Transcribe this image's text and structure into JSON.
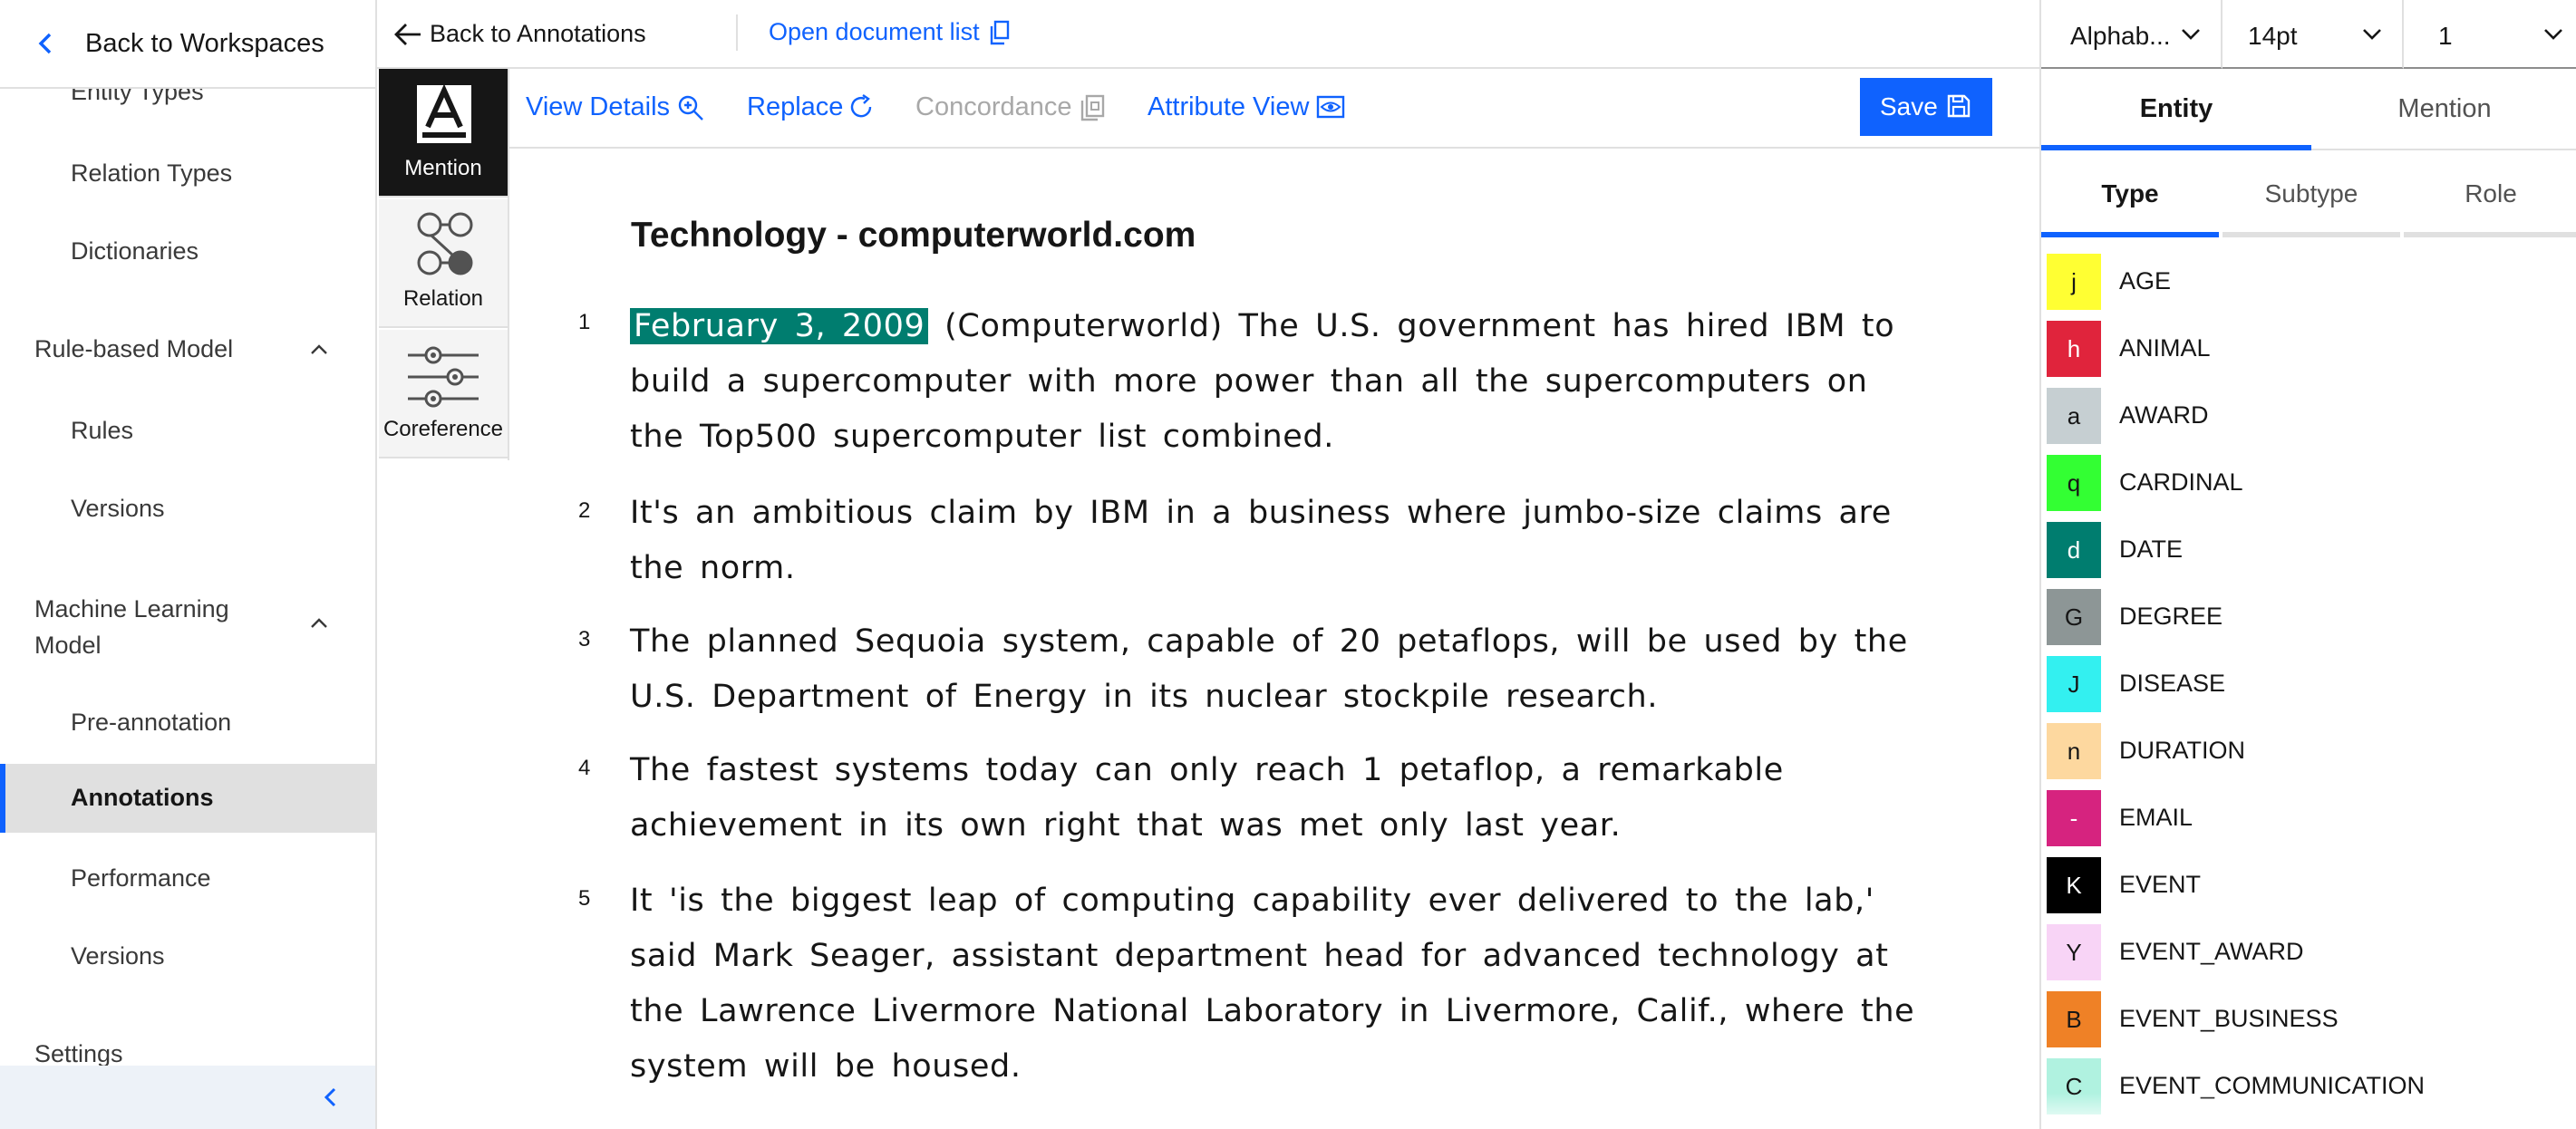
{
  "nav": {
    "back_label": "Back to Workspaces",
    "entity_types": "Entity Types",
    "relation_types": "Relation Types",
    "dictionaries": "Dictionaries",
    "rule_based_model": "Rule-based Model",
    "rules": "Rules",
    "rb_versions": "Versions",
    "ml_model_line1": "Machine Learning",
    "ml_model_line2": "Model",
    "pre_annotation": "Pre-annotation",
    "annotations": "Annotations",
    "performance": "Performance",
    "ml_versions": "Versions",
    "settings": "Settings"
  },
  "header": {
    "back_label": "Back to Annotations",
    "open_doc_label": "Open document list"
  },
  "tools": {
    "mention": "Mention",
    "relation": "Relation",
    "coreference": "Coreference"
  },
  "toolbar": {
    "view_details": "View Details",
    "replace": "Replace",
    "concordance": "Concordance",
    "attribute_view": "Attribute View",
    "save": "Save"
  },
  "document": {
    "title": "Technology - computerworld.com",
    "paragraphs": [
      {
        "num": "1",
        "highlight": "February 3, 2009",
        "text": " (Computerworld) The U.S. government has hired IBM to build  a supercomputer with more power than all the supercomputers on the Top500 supercomputer list combined."
      },
      {
        "num": "2",
        "text": "It's an ambitious claim by IBM in a business where jumbo-size claims are the norm."
      },
      {
        "num": "3",
        "text": "The planned Sequoia system, capable of 20 petaflops, will be used by the U.S. Department of Energy in its nuclear stockpile research."
      },
      {
        "num": "4",
        "text": "The fastest systems today can only reach 1 petaflop, a remarkable achievement in its own right that was met only last year."
      },
      {
        "num": "5",
        "text": "It 'is the biggest leap of computing capability ever delivered to the lab,' said Mark Seager, assistant department head for advanced technology at the Lawrence Livermore National Laboratory in Livermore, Calif., where the system will be housed."
      }
    ],
    "highlight_color": "#007d6f"
  },
  "right_panel": {
    "sort_value": "Alphab...",
    "font_size_value": "14pt",
    "line_spacing_value": "1",
    "tabs": [
      "Entity",
      "Mention"
    ],
    "subtabs": [
      "Type",
      "Subtype",
      "Role"
    ],
    "entities": [
      {
        "key": "j",
        "name": "AGE",
        "color": "#ffff33",
        "text_color": "#161616"
      },
      {
        "key": "h",
        "name": "ANIMAL",
        "color": "#e0243c",
        "text_color": "#ffffff"
      },
      {
        "key": "a",
        "name": "AWARD",
        "color": "#c6cfd2",
        "text_color": "#161616"
      },
      {
        "key": "q",
        "name": "CARDINAL",
        "color": "#33ff33",
        "text_color": "#161616"
      },
      {
        "key": "d",
        "name": "DATE",
        "color": "#007d6f",
        "text_color": "#ffffff"
      },
      {
        "key": "G",
        "name": "DEGREE",
        "color": "#8d9696",
        "text_color": "#161616"
      },
      {
        "key": "J",
        "name": "DISEASE",
        "color": "#33f0f0",
        "text_color": "#161616"
      },
      {
        "key": "n",
        "name": "DURATION",
        "color": "#fdd89f",
        "text_color": "#161616"
      },
      {
        "key": "-",
        "name": "EMAIL",
        "color": "#d6237f",
        "text_color": "#ffffff"
      },
      {
        "key": "K",
        "name": "EVENT",
        "color": "#000000",
        "text_color": "#ffffff"
      },
      {
        "key": "Y",
        "name": "EVENT_AWARD",
        "color": "#f8d4f6",
        "text_color": "#161616"
      },
      {
        "key": "B",
        "name": "EVENT_BUSINESS",
        "color": "#ef8126",
        "text_color": "#161616"
      },
      {
        "key": "C",
        "name": "EVENT_COMMUNICATION",
        "color": "#b0f2e0",
        "text_color": "#161616"
      }
    ]
  },
  "colors": {
    "accent": "#0f62fe",
    "selected_nav_bg": "#e0e0e0",
    "tool_active_bg": "#161616"
  }
}
